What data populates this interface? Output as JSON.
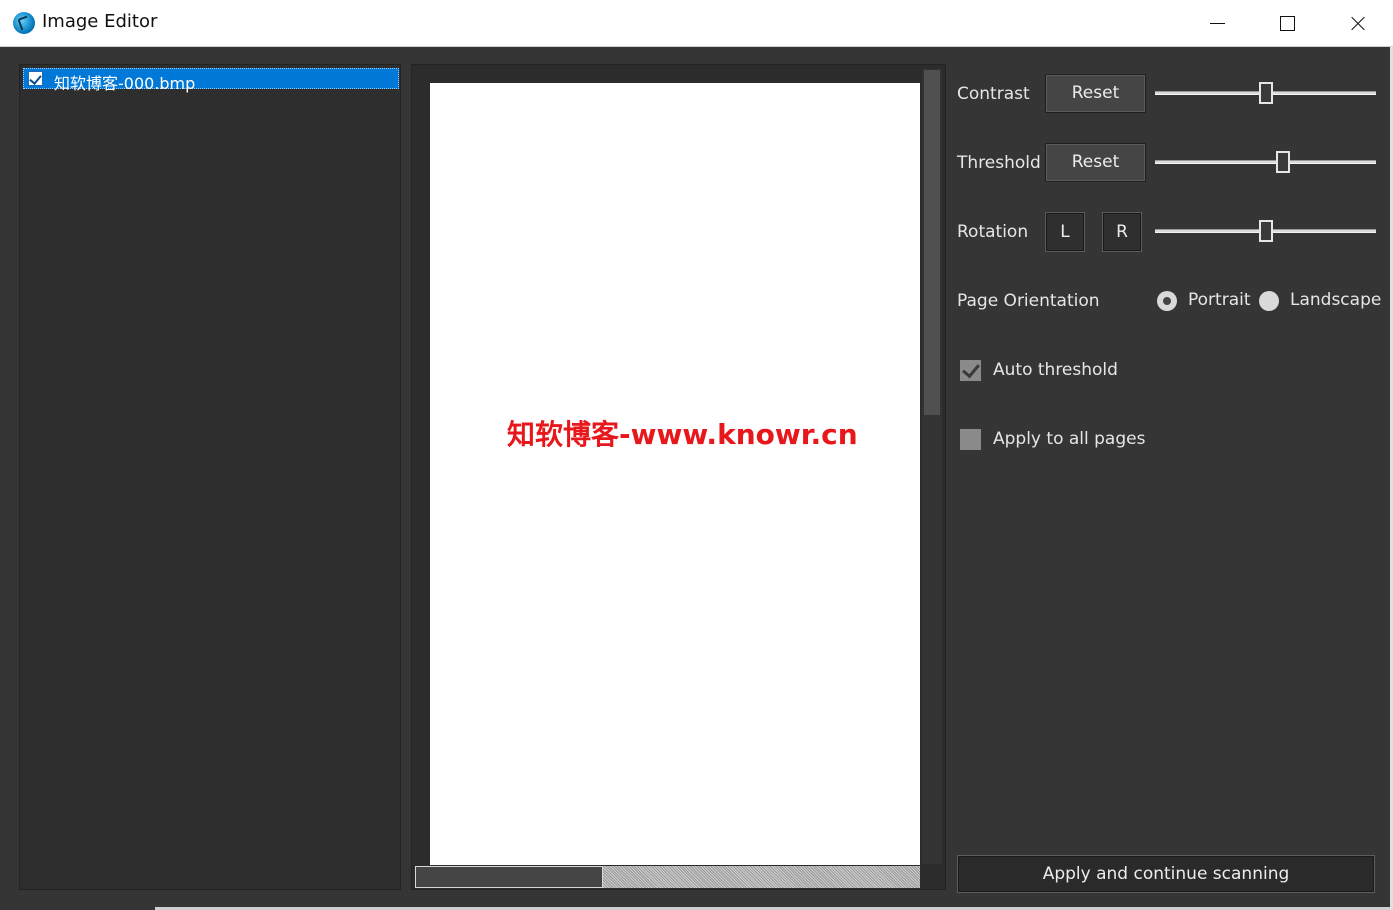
{
  "window": {
    "title": "Image Editor",
    "icon": "app-globe-icon"
  },
  "file_list": {
    "items": [
      {
        "label": "知软博客-000.bmp",
        "checked": true,
        "selected": true
      }
    ]
  },
  "preview": {
    "watermark": "知软博客-www.knowr.cn",
    "vertical_scroll_fraction": 0.43,
    "horizontal_scroll_fraction": 0.37
  },
  "controls": {
    "contrast": {
      "label": "Contrast",
      "reset_label": "Reset",
      "value_fraction": 0.5
    },
    "threshold": {
      "label": "Threshold",
      "reset_label": "Reset",
      "value_fraction": 0.58
    },
    "rotation": {
      "label": "Rotation",
      "left_label": "L",
      "right_label": "R",
      "value_fraction": 0.5
    },
    "orientation": {
      "label": "Page Orientation",
      "options": [
        "Portrait",
        "Landscape"
      ],
      "selected": "Portrait"
    },
    "auto_threshold": {
      "label": "Auto threshold",
      "checked": true
    },
    "apply_all": {
      "label": "Apply to all pages",
      "checked": false
    },
    "apply_button": "Apply and continue scanning"
  },
  "colors": {
    "background": "#353535",
    "selection": "#0078d7",
    "watermark": "#e8171b"
  }
}
